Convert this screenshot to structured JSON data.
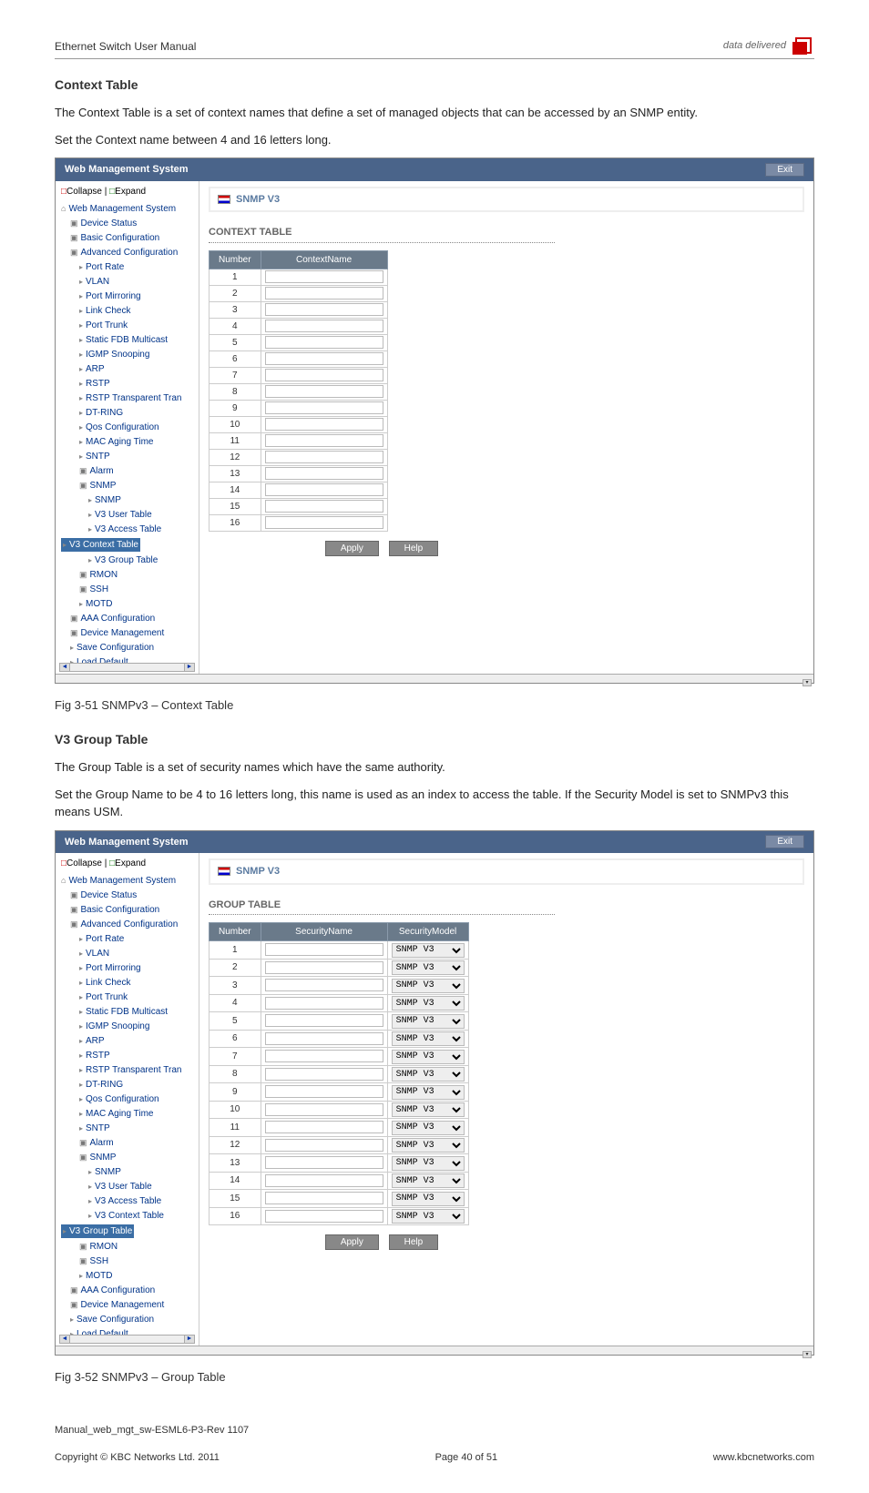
{
  "header": {
    "manual_title": "Ethernet Switch User Manual",
    "brand_tagline": "data delivered"
  },
  "section1": {
    "heading": "Context Table",
    "para1": "The Context Table is a set of context names that define a set of managed objects that can be accessed by an SNMP entity.",
    "para2": "Set the Context name between 4 and 16 letters long.",
    "caption": "Fig 3-51 SNMPv3 – Context Table"
  },
  "section2": {
    "heading": "V3 Group Table",
    "para1": "The Group Table is a set of security names which have the same authority.",
    "para2": "Set the Group Name to be 4 to 16 letters long, this name is used as an index to access the table. If the Security Model is set to SNMPv3 this means USM.",
    "caption": "Fig 3-52 SNMPv3 – Group Table"
  },
  "screenshot_common": {
    "window_title": "Web Management System",
    "exit_label": "Exit",
    "collapse_label": "Collapse",
    "expand_label": "Expand",
    "breadcrumb": "SNMP V3",
    "apply_label": "Apply",
    "help_label": "Help",
    "nav": {
      "root": "Web Management System",
      "items": [
        {
          "label": "Device Status",
          "type": "folder",
          "depth": 1
        },
        {
          "label": "Basic Configuration",
          "type": "folder",
          "depth": 1
        },
        {
          "label": "Advanced Configuration",
          "type": "folder",
          "depth": 1,
          "open": true
        },
        {
          "label": "Port Rate",
          "type": "leaf",
          "depth": 2
        },
        {
          "label": "VLAN",
          "type": "leaf",
          "depth": 2
        },
        {
          "label": "Port Mirroring",
          "type": "leaf",
          "depth": 2
        },
        {
          "label": "Link Check",
          "type": "leaf",
          "depth": 2
        },
        {
          "label": "Port Trunk",
          "type": "leaf",
          "depth": 2
        },
        {
          "label": "Static FDB Multicast",
          "type": "leaf",
          "depth": 2
        },
        {
          "label": "IGMP Snooping",
          "type": "leaf",
          "depth": 2
        },
        {
          "label": "ARP",
          "type": "leaf",
          "depth": 2
        },
        {
          "label": "RSTP",
          "type": "leaf",
          "depth": 2
        },
        {
          "label": "RSTP Transparent Tran",
          "type": "leaf",
          "depth": 2
        },
        {
          "label": "DT-RING",
          "type": "leaf",
          "depth": 2
        },
        {
          "label": "Qos Configuration",
          "type": "leaf",
          "depth": 2
        },
        {
          "label": "MAC Aging Time",
          "type": "leaf",
          "depth": 2
        },
        {
          "label": "SNTP",
          "type": "leaf",
          "depth": 2
        },
        {
          "label": "Alarm",
          "type": "folder",
          "depth": 2
        },
        {
          "label": "SNMP",
          "type": "folder",
          "depth": 2,
          "open": true
        },
        {
          "label": "SNMP",
          "type": "leaf",
          "depth": 3
        },
        {
          "label": "V3 User Table",
          "type": "leaf",
          "depth": 3
        },
        {
          "label": "V3 Access Table",
          "type": "leaf",
          "depth": 3
        },
        {
          "label": "V3 Context Table",
          "type": "leaf",
          "depth": 3,
          "sel_ctx": true
        },
        {
          "label": "V3 Group Table",
          "type": "leaf",
          "depth": 3,
          "sel_grp": true
        },
        {
          "label": "RMON",
          "type": "folder",
          "depth": 2
        },
        {
          "label": "SSH",
          "type": "folder",
          "depth": 2
        },
        {
          "label": "MOTD",
          "type": "leaf",
          "depth": 2
        },
        {
          "label": "AAA Configuration",
          "type": "folder",
          "depth": 1
        },
        {
          "label": "Device Management",
          "type": "folder",
          "depth": 1
        },
        {
          "label": "Save Configuration",
          "type": "leaf",
          "depth": 1
        },
        {
          "label": "Load Default",
          "type": "leaf",
          "depth": 1
        }
      ]
    }
  },
  "context_table": {
    "panel_title": "CONTEXT TABLE",
    "columns": [
      "Number",
      "ContextName"
    ],
    "rows": [
      {
        "num": 1,
        "value": ""
      },
      {
        "num": 2,
        "value": ""
      },
      {
        "num": 3,
        "value": ""
      },
      {
        "num": 4,
        "value": ""
      },
      {
        "num": 5,
        "value": ""
      },
      {
        "num": 6,
        "value": ""
      },
      {
        "num": 7,
        "value": ""
      },
      {
        "num": 8,
        "value": ""
      },
      {
        "num": 9,
        "value": ""
      },
      {
        "num": 10,
        "value": ""
      },
      {
        "num": 11,
        "value": ""
      },
      {
        "num": 12,
        "value": ""
      },
      {
        "num": 13,
        "value": ""
      },
      {
        "num": 14,
        "value": ""
      },
      {
        "num": 15,
        "value": ""
      },
      {
        "num": 16,
        "value": ""
      }
    ]
  },
  "group_table": {
    "panel_title": "GROUP TABLE",
    "columns": [
      "Number",
      "SecurityName",
      "SecurityModel"
    ],
    "model_option": "SNMP V3",
    "rows": [
      {
        "num": 1,
        "name": "",
        "model": "SNMP V3"
      },
      {
        "num": 2,
        "name": "",
        "model": "SNMP V3"
      },
      {
        "num": 3,
        "name": "",
        "model": "SNMP V3"
      },
      {
        "num": 4,
        "name": "",
        "model": "SNMP V3"
      },
      {
        "num": 5,
        "name": "",
        "model": "SNMP V3"
      },
      {
        "num": 6,
        "name": "",
        "model": "SNMP V3"
      },
      {
        "num": 7,
        "name": "",
        "model": "SNMP V3"
      },
      {
        "num": 8,
        "name": "",
        "model": "SNMP V3"
      },
      {
        "num": 9,
        "name": "",
        "model": "SNMP V3"
      },
      {
        "num": 10,
        "name": "",
        "model": "SNMP V3"
      },
      {
        "num": 11,
        "name": "",
        "model": "SNMP V3"
      },
      {
        "num": 12,
        "name": "",
        "model": "SNMP V3"
      },
      {
        "num": 13,
        "name": "",
        "model": "SNMP V3"
      },
      {
        "num": 14,
        "name": "",
        "model": "SNMP V3"
      },
      {
        "num": 15,
        "name": "",
        "model": "SNMP V3"
      },
      {
        "num": 16,
        "name": "",
        "model": "SNMP V3"
      }
    ]
  },
  "footer": {
    "manual_ref": "Manual_web_mgt_sw-ESML6-P3-Rev 1107",
    "copyright": "Copyright © KBC Networks Ltd. 2011",
    "page": "Page 40 of 51",
    "site": "www.kbcnetworks.com"
  }
}
